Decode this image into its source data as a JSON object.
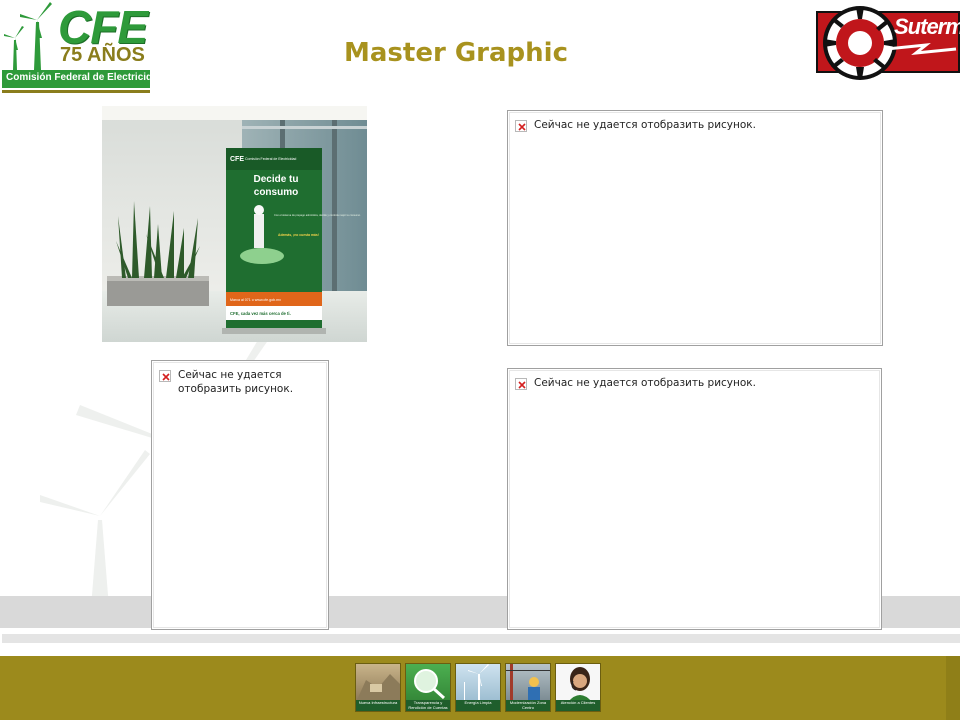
{
  "slide": {
    "title": "Master Graphic"
  },
  "logos": {
    "cfe": {
      "brand": "CFE",
      "anniversary": "75 AÑOS",
      "name": "Comisión Federal de Electricidad"
    },
    "suterm": {
      "brand": "Suterm"
    }
  },
  "placeholders": [
    {
      "message": "Сейчас не удается отобразить рисунок."
    },
    {
      "message": "Сейчас не удается отобразить рисунок."
    },
    {
      "message": "Сейчас не удается отобразить рисунок."
    }
  ],
  "banner_photo": {
    "banner_brand": "CFE",
    "banner_org": "Comisión Federal de Electricidad",
    "banner_headline_1": "Decide tu",
    "banner_headline_2": "consumo",
    "banner_body": "Con el sistema de prepago administra, decide y controla mejor tu consumo.",
    "banner_tagline": "Además, ¡no cuesta más!",
    "banner_contact": "Marca al 071 o www.cfe.gob.mx",
    "banner_slogan": "CFE, cada vez más cerca de ti."
  },
  "footer": {
    "thumbnails": [
      {
        "icon": "construction-thumbnail",
        "caption": "Nueva Infraestructura"
      },
      {
        "icon": "magnifier-thumbnail",
        "caption": "Transparencia y Rendición de Cuentas"
      },
      {
        "icon": "windmill-thumbnail",
        "caption": "Energía Limpia"
      },
      {
        "icon": "lineman-thumbnail",
        "caption": "Modernización Zona Centro"
      },
      {
        "icon": "operator-thumbnail",
        "caption": "Atención a Clientes"
      }
    ]
  },
  "colors": {
    "title": "#a8921e",
    "cfe_green": "#2e9a3a",
    "footer_olive": "#9c8a1c",
    "suterm_red": "#c0161b"
  }
}
